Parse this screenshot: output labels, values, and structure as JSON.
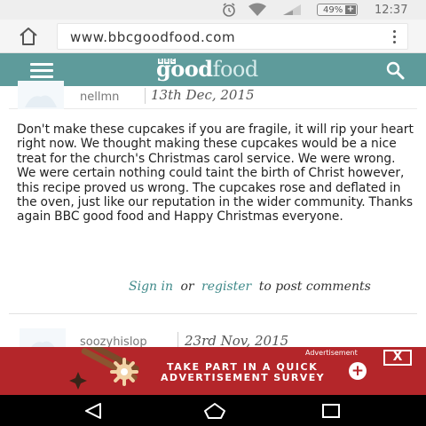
{
  "status_bar": {
    "battery_percent": "49%",
    "battery_plus": "+",
    "time": "12:37",
    "icons": [
      "alarm-icon",
      "wifi-icon",
      "signal-icon",
      "battery-icon"
    ]
  },
  "browser": {
    "url": "www.bbcgoodfood.com",
    "icons": [
      "home-icon",
      "overflow-menu-icon"
    ]
  },
  "site_header": {
    "logo_part1": "good",
    "logo_part2": "food",
    "logo_bbc_letters": [
      "B",
      "B",
      "C"
    ],
    "icons": [
      "hamburger-menu-icon",
      "search-icon"
    ],
    "color": "#5e9b9b"
  },
  "comments": [
    {
      "user": "nellmn",
      "date": "13th Dec, 2015",
      "body": "Don't make these cupcakes if you are fragile, it will rip your heart right now. We thought making these cupcakes would be a nice treat for the church's Christmas carol service. We were wrong. We were certain nothing could taint the birth of Christ however, this recipe proved us wrong. The cupcakes rose and deflated in the oven, just like our reputation in the wider community. Thanks again BBC good food and Happy Christmas everyone."
    },
    {
      "user": "soozyhislop",
      "date": "23rd Nov, 2015"
    }
  ],
  "post_prompt": {
    "signin": "Sign in",
    "or": "or",
    "register": "register",
    "suffix": "to post comments"
  },
  "ad": {
    "label": "Advertisement",
    "close": "X",
    "line1": "TAKE PART IN A QUICK",
    "line2": "ADVERTISEMENT SURVEY",
    "plus": "+",
    "color": "#b4262a"
  },
  "nav_bar": {
    "icons": [
      "back-icon",
      "home-icon",
      "recent-apps-icon"
    ]
  }
}
